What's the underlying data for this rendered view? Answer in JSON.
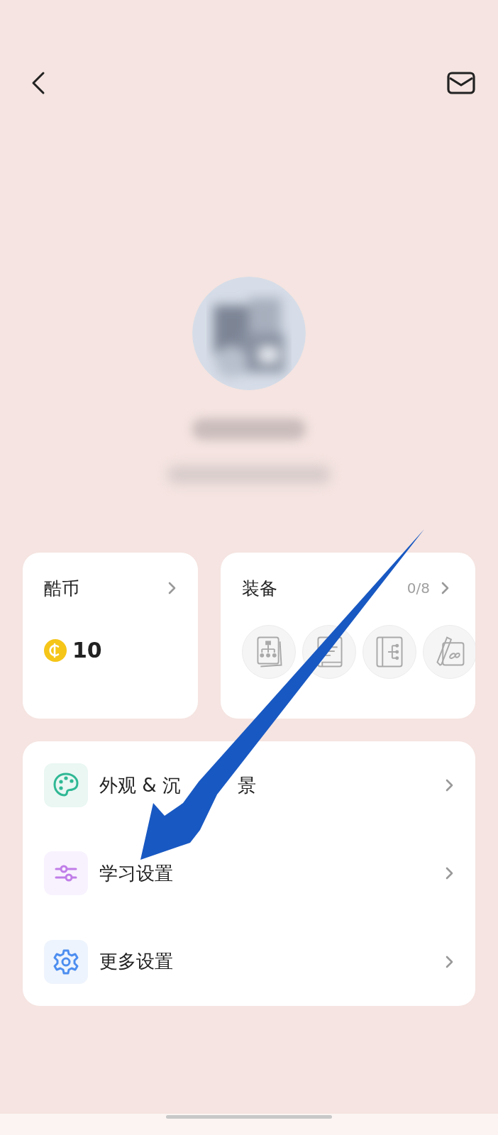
{
  "coins_card": {
    "title": "酷币",
    "amount": "10"
  },
  "equipment_card": {
    "title": "装备",
    "count": "0/8",
    "slots": [
      {
        "kind": "chart"
      },
      {
        "kind": "book"
      },
      {
        "kind": "tree"
      },
      {
        "kind": "sketch"
      }
    ]
  },
  "settings": [
    {
      "label_parts": [
        "外观 & 沉",
        "景"
      ],
      "kind": "palette"
    },
    {
      "label": "学习设置",
      "kind": "sliders"
    },
    {
      "label": "更多设置",
      "kind": "gear"
    }
  ]
}
